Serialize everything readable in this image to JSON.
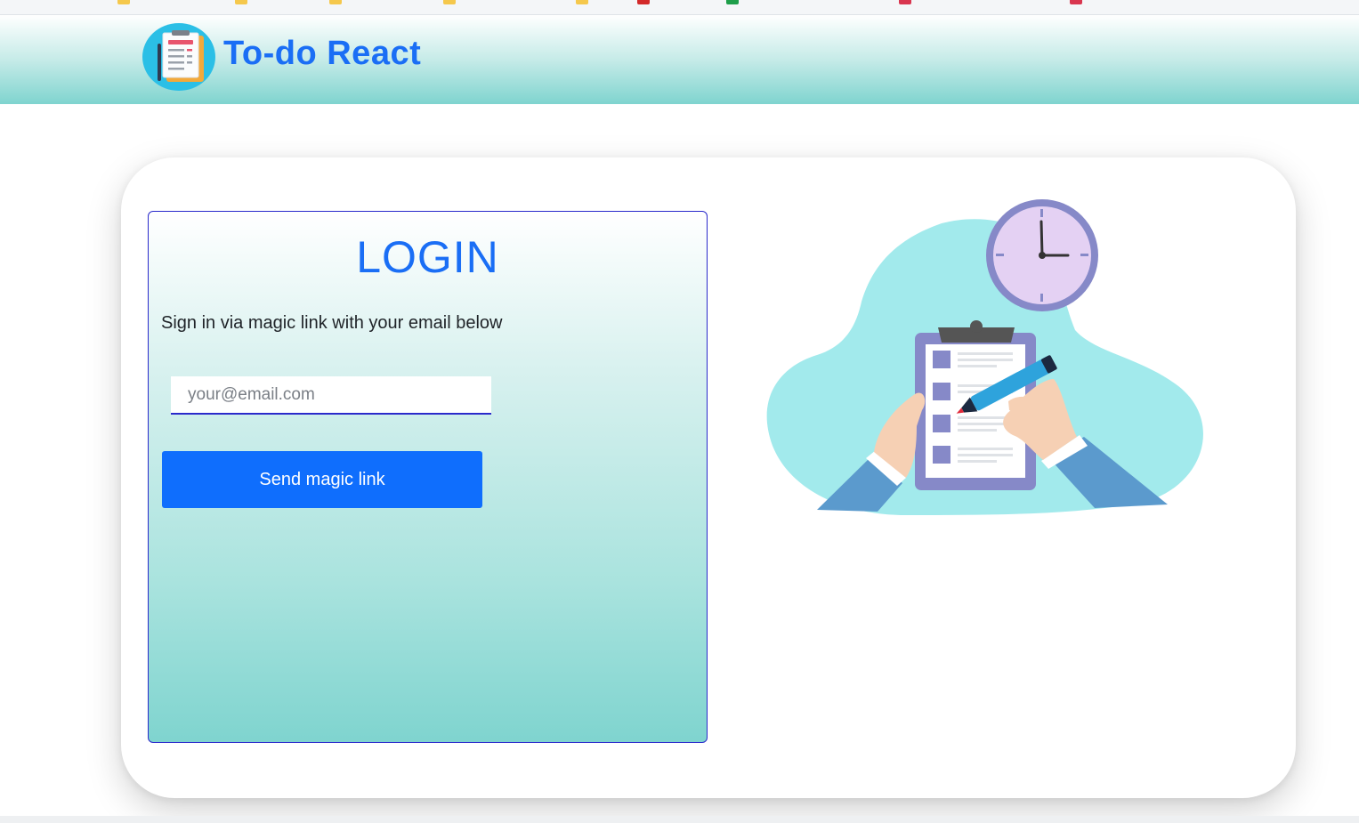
{
  "app": {
    "brand": "To-do React"
  },
  "login": {
    "title": "LOGIN",
    "subtitle": "Sign in via magic link with your email below",
    "email_placeholder": "your@email.com",
    "email_value": "",
    "submit_label": "Send magic link"
  },
  "icons": {
    "logo": "clipboard-checklist-icon",
    "illustration": "checklist-clock-illustration"
  },
  "colors": {
    "brand_blue": "#1a6ef5",
    "button_blue": "#0f6efd",
    "panel_border": "#2a2acb",
    "teal_accent": "#7fd4cf",
    "illustration_blob": "#a2eaec",
    "clock_face": "#e4d1f3",
    "clock_ring": "#8689c8"
  }
}
